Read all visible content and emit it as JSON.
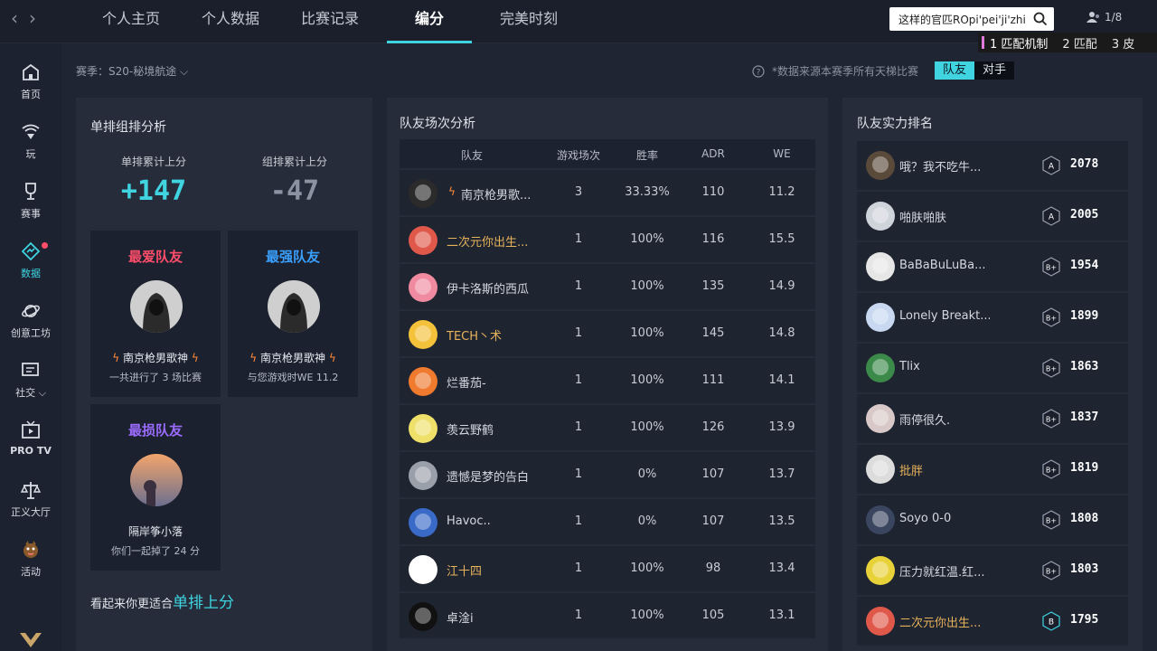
{
  "nav": {
    "back": "‹",
    "forward": "›",
    "tabs": [
      "个人主页",
      "个人数据",
      "比赛记录",
      "编分",
      "完美时刻"
    ]
  },
  "search": {
    "value": "这样的官匹ROpi'pei'ji'zhi"
  },
  "online": {
    "count": "1/8"
  },
  "ime": {
    "candidates": [
      "1 匹配机制",
      "2 匹配",
      "3 皮"
    ]
  },
  "sidebar": {
    "items": [
      "首页",
      "玩",
      "赛事",
      "数据",
      "创意工坊",
      "社交 ⌵",
      "PRO TV",
      "正义大厅",
      "活动"
    ]
  },
  "season": {
    "label": "赛季：S20-秘境航途 ⌵"
  },
  "note": {
    "text": "*数据来源本赛季所有天梯比赛"
  },
  "toggle": {
    "teammate": "队友",
    "opponent": "对手"
  },
  "left": {
    "title": "单排组排分析",
    "solo_label": "单排累计上分",
    "solo_value": "+147",
    "group_label": "组排累计上分",
    "group_value": "-47",
    "card1": {
      "title": "最爱队友",
      "name": "南京枪男歌神",
      "sub": "一共进行了 3 场比赛"
    },
    "card2": {
      "title": "最强队友",
      "name": "南京枪男歌神",
      "sub": "与您游戏时WE 11.2"
    },
    "card3": {
      "title": "最损队友",
      "name": "隔岸筝小落",
      "sub": "你们一起掉了 24 分"
    },
    "suggest_prefix": "看起来你更适合",
    "suggest_highlight": "单排上分"
  },
  "middle": {
    "title": "队友场次分析",
    "headers": [
      "队友",
      "游戏场次",
      "胜率",
      "ADR",
      "WE"
    ],
    "rows": [
      {
        "name": "南京枪男歌...",
        "games": "3",
        "win": "33.33%",
        "adr": "110",
        "we": "11.2"
      },
      {
        "name": "二次元你出生...",
        "games": "1",
        "win": "100%",
        "adr": "116",
        "we": "15.5"
      },
      {
        "name": "伊卡洛斯的西瓜",
        "games": "1",
        "win": "100%",
        "adr": "135",
        "we": "14.9"
      },
      {
        "name": "TECH丶术",
        "games": "1",
        "win": "100%",
        "adr": "145",
        "we": "14.8"
      },
      {
        "name": "烂番茄-",
        "games": "1",
        "win": "100%",
        "adr": "111",
        "we": "14.1"
      },
      {
        "name": "羡云野鹤",
        "games": "1",
        "win": "100%",
        "adr": "126",
        "we": "13.9"
      },
      {
        "name": "遗憾是梦的告白",
        "games": "1",
        "win": "0%",
        "adr": "107",
        "we": "13.7"
      },
      {
        "name": "Havoc..",
        "games": "1",
        "win": "0%",
        "adr": "107",
        "we": "13.5"
      },
      {
        "name": "江十四",
        "games": "1",
        "win": "100%",
        "adr": "98",
        "we": "13.4"
      },
      {
        "name": "卓淦i",
        "games": "1",
        "win": "100%",
        "adr": "105",
        "we": "13.1"
      }
    ]
  },
  "right": {
    "title": "队友实力排名",
    "rows": [
      {
        "name": "哦？我不吃牛...",
        "badge": "A",
        "score": "2078"
      },
      {
        "name": "啪肤啪肤",
        "badge": "A",
        "score": "2005"
      },
      {
        "name": "BaBaBuLuBa...",
        "badge": "B+",
        "score": "1954"
      },
      {
        "name": "Lonely Breakt...",
        "badge": "B+",
        "score": "1899"
      },
      {
        "name": "Tlix",
        "badge": "B+",
        "score": "1863"
      },
      {
        "name": "雨停很久.",
        "badge": "B+",
        "score": "1837"
      },
      {
        "name": "批胖",
        "badge": "B+",
        "score": "1819"
      },
      {
        "name": "Soyo 0-0",
        "badge": "B+",
        "score": "1808"
      },
      {
        "name": "压力就红温.红...",
        "badge": "B+",
        "score": "1803"
      },
      {
        "name": "二次元你出生...",
        "badge": "B",
        "score": "1795"
      }
    ]
  },
  "colors": {
    "accent": "#3fd4e0",
    "red": "#ff4d6a",
    "gold": "#e6b25a",
    "purple": "#9b6cff",
    "blue": "#3aa0ff"
  }
}
